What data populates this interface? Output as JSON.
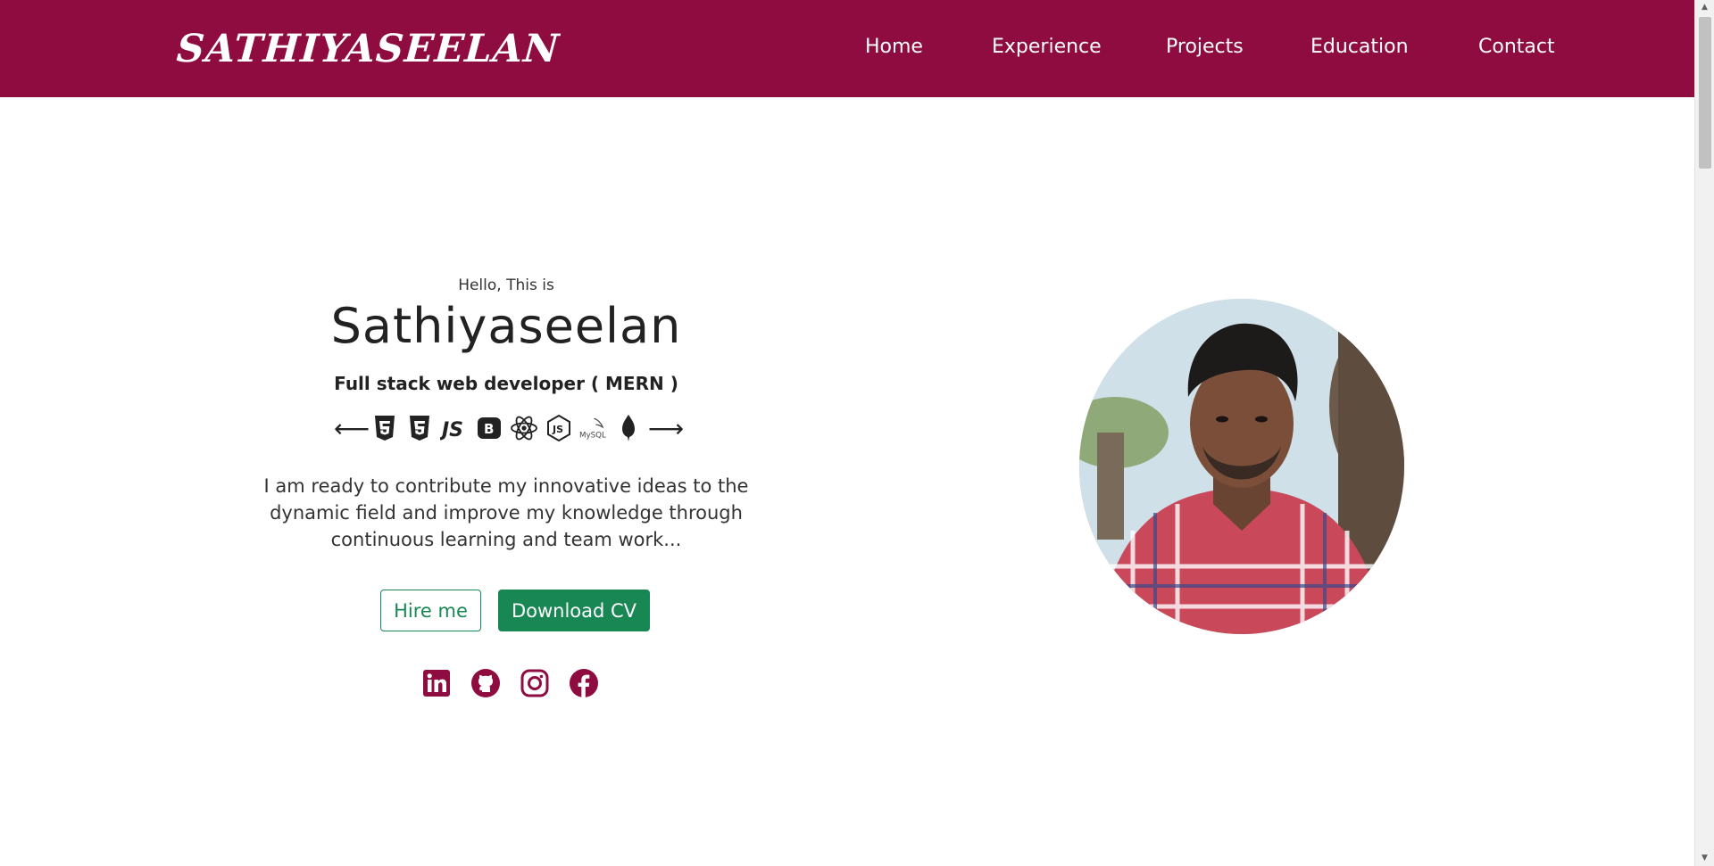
{
  "navbar": {
    "brand": "SATHIYASEELAN",
    "links": [
      {
        "label": "Home"
      },
      {
        "label": "Experience"
      },
      {
        "label": "Projects"
      },
      {
        "label": "Education"
      },
      {
        "label": "Contact"
      }
    ],
    "background_color": "#8e0c40"
  },
  "hero": {
    "greeting": "Hello, This is",
    "name": "Sathiyaseelan",
    "role": "Full stack web developer ( MERN )",
    "tech_icons": [
      "html5-icon",
      "css3-icon",
      "js-icon",
      "bootstrap-icon",
      "react-icon",
      "nodejs-icon",
      "mysql-icon",
      "mongodb-icon"
    ],
    "about": "I am ready to contribute my innovative ideas to the dynamic field and improve my knowledge through continuous learning and team work...",
    "hire_label": "Hire me",
    "cv_label": "Download CV",
    "accent_color": "#198754",
    "social_icons": [
      "linkedin-icon",
      "github-icon",
      "instagram-icon",
      "facebook-icon"
    ]
  }
}
